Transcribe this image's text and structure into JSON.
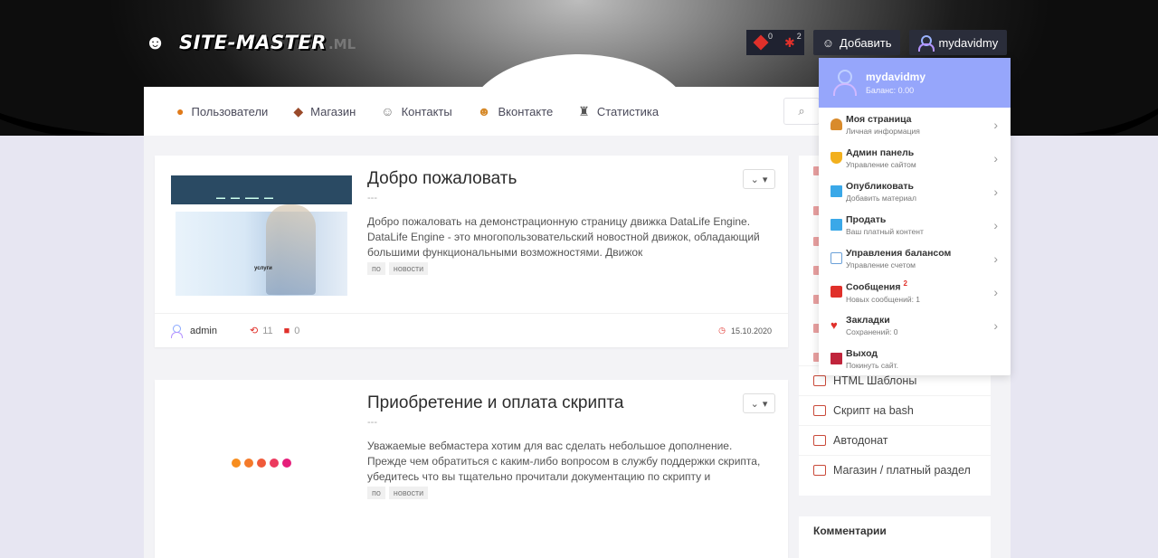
{
  "header": {
    "brand": "SITE-MASTER",
    "tld": ".ML",
    "gems_count": "0",
    "bugs_count": "2",
    "add_label": "Добавить",
    "username": "mydavidmy"
  },
  "nav": {
    "items": [
      {
        "label": "Пользователи",
        "icon": "pumpkin-icon"
      },
      {
        "label": "Магазин",
        "icon": "chocolate-icon"
      },
      {
        "label": "Контакты",
        "icon": "ghost-contacts-icon"
      },
      {
        "label": "Вконтакте",
        "icon": "masks-icon"
      },
      {
        "label": "Статистика",
        "icon": "chart-icon"
      }
    ]
  },
  "posts": [
    {
      "title": "Добро пожаловать",
      "dash": "---",
      "text": "Добро пожаловать на демонстрационную страницу движка DataLife Engine. DataLife Engine - это многопользовательский новостной движок, обладающий большими функциональными возможностями. Движок",
      "tags": [
        "по",
        "новости"
      ],
      "thumb_caption": "услуги",
      "author": "admin",
      "views": "11",
      "comments": "0",
      "date": "15.10.2020"
    },
    {
      "title": "Приобретение и оплата скрипта",
      "dash": "---",
      "text": "Уважаемые вебмастера хотим для вас сделать небольшое дополнение. Прежде чем обратиться с каким-либо вопросом в службу поддержки скрипта, убедитесь что вы тщательно прочитали документацию по скрипту и",
      "tags": [
        "по",
        "новости"
      ]
    }
  ],
  "sidebar": {
    "links": [
      {
        "label": "HTML Шаблоны"
      },
      {
        "label": "Скрипт на bash"
      },
      {
        "label": "Автодонат"
      },
      {
        "label": "Магазин / платный раздел"
      }
    ],
    "comments_title": "Комментарии"
  },
  "user_menu": {
    "name": "mydavidmy",
    "balance": "Баланс: 0.00",
    "items": [
      {
        "title": "Моя страница",
        "sub": "Личная информация",
        "icon": "user-page-icon",
        "color": "#d98b2b"
      },
      {
        "title": "Админ панель",
        "sub": "Управление сайтом",
        "icon": "shield-icon",
        "color": "#f2b01e"
      },
      {
        "title": "Опубликовать",
        "sub": "Добавить материал",
        "icon": "publish-icon",
        "color": "#3aa8e8"
      },
      {
        "title": "Продать",
        "sub": "Ваш платный контент",
        "icon": "sell-icon",
        "color": "#3aa8e8"
      },
      {
        "title": "Управления балансом",
        "sub": "Управление счетом",
        "icon": "balance-icon",
        "color": "#6aa0d8"
      },
      {
        "title": "Сообщения",
        "sup": "2",
        "sub": "Новых сообщений: 1",
        "icon": "messages-icon",
        "color": "#e0302a"
      },
      {
        "title": "Закладки",
        "sub": "Сохранений: 0",
        "icon": "heart-icon",
        "color": "#e0302a"
      },
      {
        "title": "Выход",
        "sub": "Покинуть сайт.",
        "icon": "exit-icon",
        "color": "#c0243b"
      }
    ]
  }
}
